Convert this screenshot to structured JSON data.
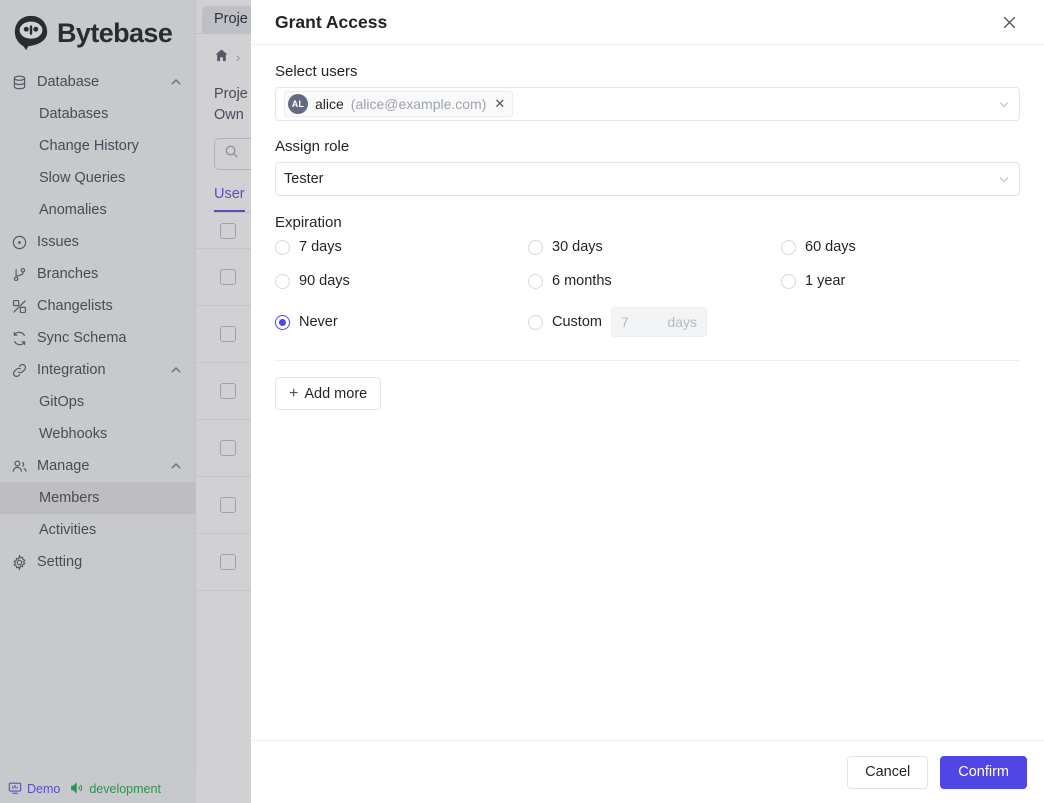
{
  "brand": {
    "name": "Bytebase",
    "logo_icon": "bytebase-logo-icon"
  },
  "sidebar": {
    "groups": [
      {
        "label": "Database",
        "icon": "database-icon",
        "expanded": true,
        "chevron_icon": "chevron-up-icon",
        "items": [
          {
            "label": "Databases"
          },
          {
            "label": "Change History"
          },
          {
            "label": "Slow Queries"
          },
          {
            "label": "Anomalies"
          }
        ]
      }
    ],
    "links": [
      {
        "label": "Issues",
        "icon": "issues-circle-icon"
      },
      {
        "label": "Branches",
        "icon": "branch-icon"
      },
      {
        "label": "Changelists",
        "icon": "changelist-icon"
      },
      {
        "label": "Sync Schema",
        "icon": "sync-icon"
      }
    ],
    "integration": {
      "label": "Integration",
      "icon": "link-icon",
      "chevron_icon": "chevron-up-icon",
      "items": [
        {
          "label": "GitOps"
        },
        {
          "label": "Webhooks"
        }
      ]
    },
    "manage": {
      "label": "Manage",
      "icon": "users-icon",
      "chevron_icon": "chevron-up-icon",
      "items": [
        {
          "label": "Members",
          "active": true
        },
        {
          "label": "Activities",
          "active": false
        }
      ]
    },
    "setting": {
      "label": "Setting",
      "icon": "gear-icon"
    }
  },
  "statusbar": {
    "demo_label": "Demo",
    "demo_icon": "monitor-icon",
    "demo_color": "#4f46e5",
    "env_label": "development",
    "env_icon": "speaker-icon",
    "env_color": "#16a34a"
  },
  "background": {
    "tab_label": "Proje",
    "breadcrumb": {
      "home_icon": "home-icon",
      "separator": "›"
    },
    "project_line1": "Proje",
    "project_line2": "Own",
    "search_icon": "search-icon",
    "tab_user": "User",
    "row_count": 7
  },
  "modal": {
    "title": "Grant Access",
    "close_icon": "close-icon",
    "select_users": {
      "label": "Select users",
      "chip": {
        "initials": "AL",
        "name": "alice",
        "email": "(alice@example.com)",
        "remove_icon": "close-icon"
      },
      "dropdown_icon": "chevron-down-icon"
    },
    "assign_role": {
      "label": "Assign role",
      "value": "Tester",
      "dropdown_icon": "chevron-down-icon"
    },
    "expiration": {
      "label": "Expiration",
      "options": [
        {
          "label": "7 days",
          "selected": false
        },
        {
          "label": "30 days",
          "selected": false
        },
        {
          "label": "60 days",
          "selected": false
        },
        {
          "label": "90 days",
          "selected": false
        },
        {
          "label": "6 months",
          "selected": false
        },
        {
          "label": "1 year",
          "selected": false
        },
        {
          "label": "Never",
          "selected": true
        },
        {
          "label": "Custom",
          "selected": false
        }
      ],
      "custom": {
        "placeholder": "7",
        "unit": "days"
      }
    },
    "add_more": {
      "label": "Add more",
      "plus_icon": "plus-icon"
    },
    "footer": {
      "cancel_label": "Cancel",
      "confirm_label": "Confirm",
      "confirm_color": "#4f46e5"
    }
  }
}
